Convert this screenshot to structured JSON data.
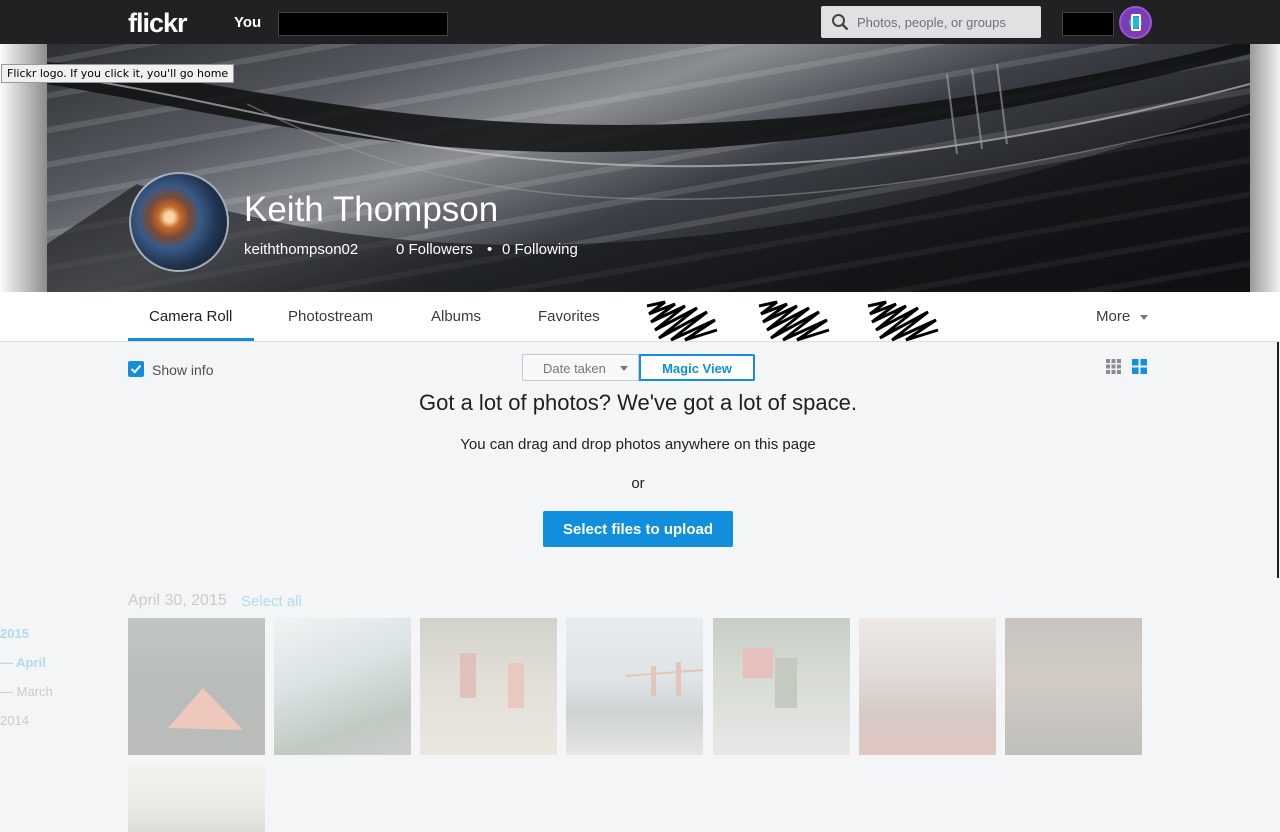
{
  "nav": {
    "logo": "flickr",
    "you": "You",
    "search_placeholder": "Photos, people, or groups"
  },
  "tooltip": "Flickr logo. If you click it, you'll go home",
  "profile": {
    "name": "Keith Thompson",
    "username": "keiththompson02",
    "followers": "0 Followers",
    "separator": "•",
    "following": "0 Following"
  },
  "tabs": [
    "Camera Roll",
    "Photostream",
    "Albums",
    "Favorites"
  ],
  "more_label": "More",
  "toolbar": {
    "show_info": "Show info",
    "sort_label": "Date taken",
    "magic_view": "Magic View"
  },
  "upload": {
    "headline": "Got a lot of photos? We've got a lot of space.",
    "subline": "You can drag and drop photos anywhere on this page",
    "or": "or",
    "button": "Select files to upload"
  },
  "section": {
    "date": "April 30, 2015",
    "select_all": "Select all"
  },
  "timeline": [
    "2015",
    "— April",
    "— March",
    "2014"
  ],
  "colors": {
    "accent": "#128fdc",
    "topbar": "#212124"
  }
}
